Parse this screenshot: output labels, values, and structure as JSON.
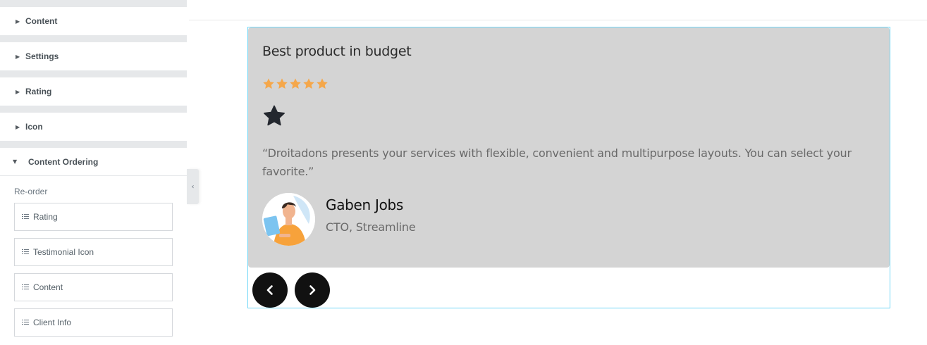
{
  "sidebar": {
    "sections": [
      {
        "label": "Content"
      },
      {
        "label": "Settings"
      },
      {
        "label": "Rating"
      },
      {
        "label": "Icon"
      }
    ],
    "open_section": {
      "label": "Content Ordering",
      "reorder_label": "Re-order",
      "items": [
        {
          "label": "Rating"
        },
        {
          "label": "Testimonial Icon"
        },
        {
          "label": "Content"
        },
        {
          "label": "Client Info"
        }
      ]
    }
  },
  "testimonial": {
    "title": "Best product in budget",
    "rating": 5,
    "rating_max": 5,
    "star_color": "#f5a74a",
    "icon": "star-icon",
    "quote": "“Droitadons presents your services with flexible, convenient and multipurpose layouts. You can select your favorite.”",
    "client_name": "Gaben Jobs",
    "client_role": "CTO, Streamline",
    "card_color": "#d4d4d4"
  },
  "carousel": {
    "prev_icon": "chevron-left-icon",
    "next_icon": "chevron-right-icon"
  },
  "colors": {
    "frame_accent": "#71d7f7",
    "nav_button": "#111111"
  }
}
